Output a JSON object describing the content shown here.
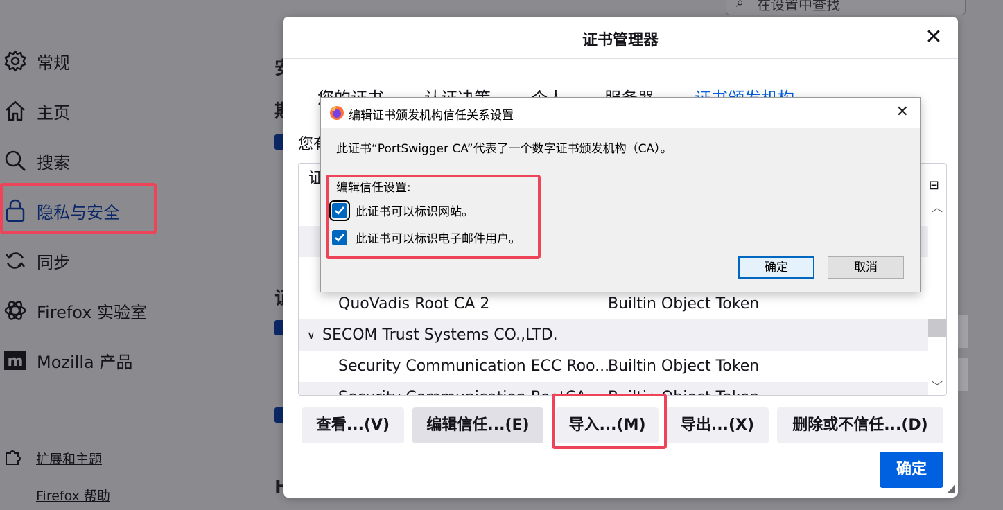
{
  "settings": {
    "search_placeholder": "在设置中查找",
    "sidebar": [
      {
        "label": "常规",
        "icon": "gear-icon"
      },
      {
        "label": "主页",
        "icon": "home-icon"
      },
      {
        "label": "搜索",
        "icon": "search-icon"
      },
      {
        "label": "隐私与安全",
        "icon": "lock-icon",
        "active": true
      },
      {
        "label": "同步",
        "icon": "sync-icon"
      },
      {
        "label": "Firefox 实验室",
        "icon": "labs-icon"
      },
      {
        "label": "Mozilla 产品",
        "icon": "mozilla-icon"
      }
    ],
    "footer": [
      {
        "label": "扩展和主题",
        "icon": "puzzle-icon"
      },
      {
        "label": "Firefox 帮助",
        "icon": "help-icon"
      }
    ]
  },
  "cert_manager": {
    "title": "证书管理器",
    "tabs": [
      "您的证书",
      "认证决策",
      "个人",
      "服务器",
      "证书颁发机构"
    ],
    "selected_tab": 4,
    "description": "您有",
    "column_header": "证",
    "rows": [
      {
        "name": "QuoVadis Root CA 2",
        "token": "Builtin Object Token",
        "indent": true,
        "alt": false
      },
      {
        "name": "SECOM Trust Systems CO.,LTD.",
        "token": "",
        "indent": false,
        "group": true,
        "alt": true
      },
      {
        "name": "Security Communication ECC Roo...",
        "token": "Builtin Object Token",
        "indent": true,
        "alt": false
      },
      {
        "name": "Security Communication RootCA...",
        "token": "Builtin Object Token",
        "indent": true,
        "alt": true
      }
    ],
    "buttons": {
      "view": "查看...(V)",
      "edit_trust": "编辑信任...(E)",
      "import": "导入...(M)",
      "export": "导出...(X)",
      "delete": "删除或不信任...(D)",
      "ok": "确定"
    }
  },
  "trust_dialog": {
    "title": "编辑证书颁发机构信任关系设置",
    "message": "此证书“PortSwigger CA”代表了一个数字证书颁发机构（CA）。",
    "group_label": "编辑信任设置:",
    "options": [
      {
        "label": "此证书可以标识网站。",
        "checked": true
      },
      {
        "label": "此证书可以标识电子邮件用户。",
        "checked": true
      }
    ],
    "ok": "确定",
    "cancel": "取消"
  },
  "background_fragments": {
    "heading_1": "安",
    "heading_2": "期",
    "heading_3": "证",
    "bottom_text": "H"
  },
  "colors": {
    "accent": "#0061e0",
    "highlight": "#ee4459",
    "checkbox": "#0067c0"
  }
}
